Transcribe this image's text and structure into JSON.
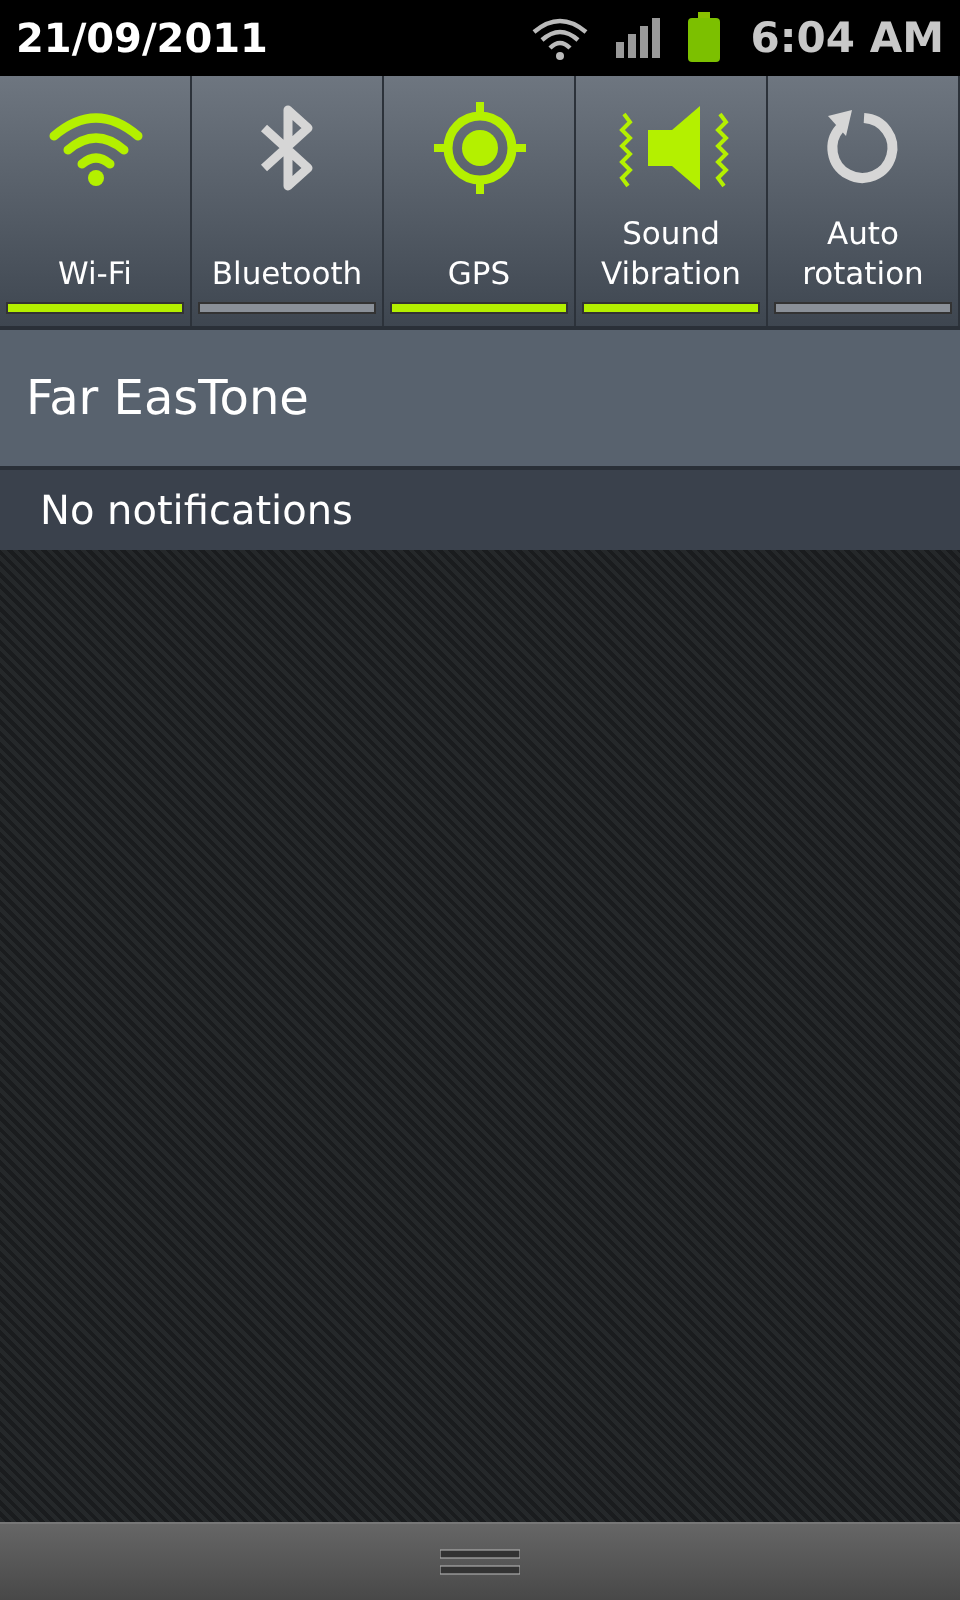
{
  "status_bar": {
    "date": "21/09/2011",
    "time": "6:04 AM"
  },
  "toggles": [
    {
      "kind": "wifi",
      "label": "Wi-Fi",
      "on": true
    },
    {
      "kind": "bluetooth",
      "label": "Bluetooth",
      "on": false
    },
    {
      "kind": "gps",
      "label": "GPS",
      "on": true
    },
    {
      "kind": "sound",
      "label": "Sound Vibration",
      "on": true
    },
    {
      "kind": "rotation",
      "label": "Auto rotation",
      "on": false
    }
  ],
  "carrier": "Far EasTone",
  "notifications_text": "No notifications"
}
